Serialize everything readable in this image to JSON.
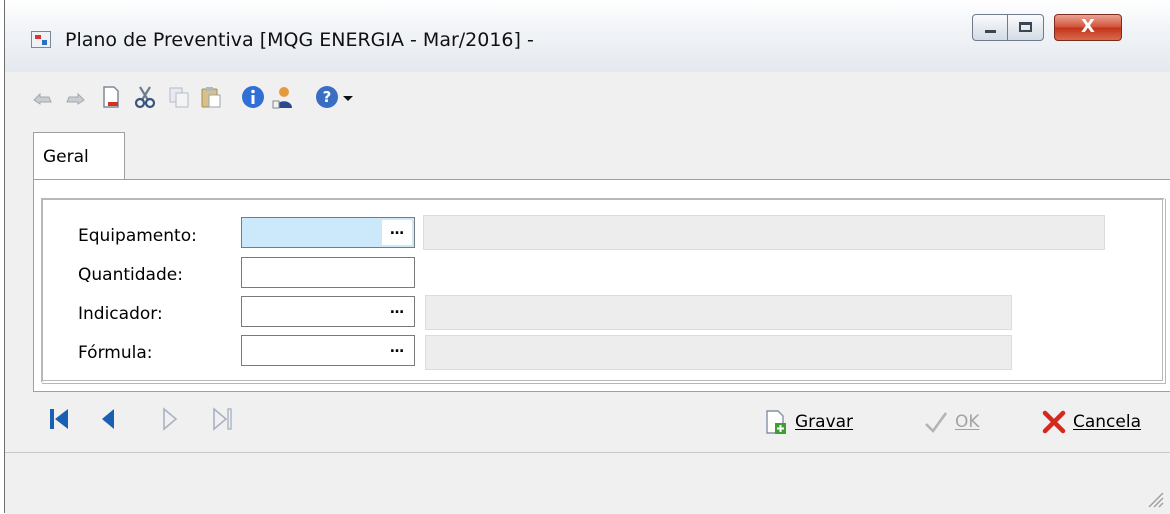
{
  "window": {
    "title": "Plano de Preventiva [MQG ENERGIA - Mar/2016]  -",
    "close_symbol": "X",
    "close_color": "#c7381d"
  },
  "toolbar": {
    "icons": [
      "undo-icon",
      "redo-icon",
      "new-document-icon",
      "cut-icon",
      "copy-icon",
      "paste-icon",
      "info-icon",
      "user-icon",
      "help-icon",
      "help-dropdown-icon"
    ]
  },
  "tabs": [
    {
      "label": "Geral",
      "active": true
    }
  ],
  "form": {
    "equipamento": {
      "label": "Equipamento:",
      "value": "",
      "button": "…"
    },
    "quantidade": {
      "label": "Quantidade:",
      "value": ""
    },
    "indicador": {
      "label": "Indicador:",
      "value": "",
      "button": "…"
    },
    "formula": {
      "label": "Fórmula:",
      "value": "",
      "button": "…"
    }
  },
  "navigation": {
    "icons": [
      "first-record-icon",
      "previous-record-icon",
      "next-record-icon",
      "last-record-icon"
    ]
  },
  "actions": {
    "save": "Gravar",
    "ok": "OK",
    "cancel": "Cancela"
  },
  "colors": {
    "accent": "#1a5fb4",
    "active_field": "#cce8fb",
    "cancel_red": "#d42a1e"
  }
}
